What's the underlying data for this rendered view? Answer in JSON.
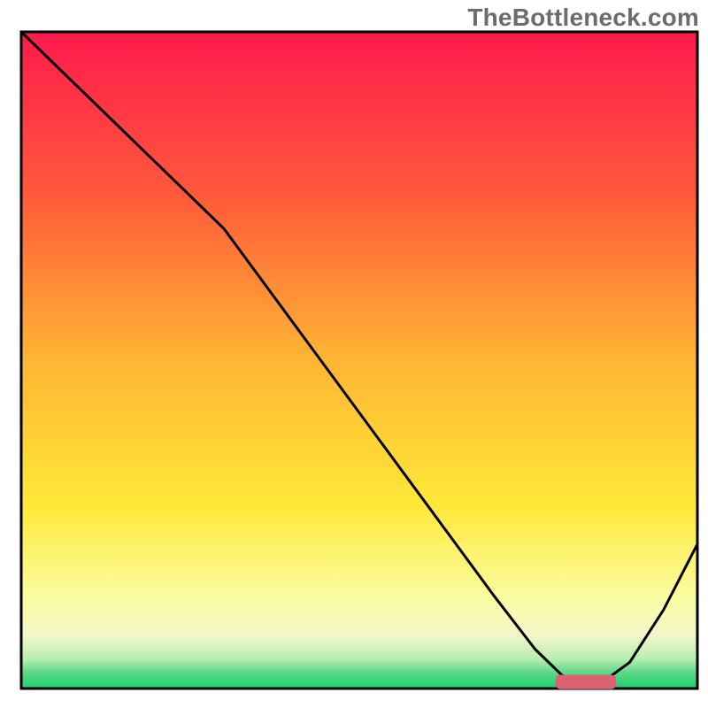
{
  "watermark": "TheBottleneck.com",
  "chart_data": {
    "type": "line",
    "title": "",
    "xlabel": "",
    "ylabel": "",
    "xlim": [
      0,
      100
    ],
    "ylim": [
      0,
      100
    ],
    "grid": false,
    "legend": false,
    "axes_visible": false,
    "background_gradient_stops": [
      {
        "offset": 0.0,
        "color": "#ff1a4d"
      },
      {
        "offset": 0.25,
        "color": "#ff5a3a"
      },
      {
        "offset": 0.5,
        "color": "#ffb534"
      },
      {
        "offset": 0.72,
        "color": "#ffe838"
      },
      {
        "offset": 0.86,
        "color": "#fbfca0"
      },
      {
        "offset": 0.92,
        "color": "#f2f7c9"
      },
      {
        "offset": 0.955,
        "color": "#b8edb0"
      },
      {
        "offset": 0.975,
        "color": "#5fd98a"
      },
      {
        "offset": 1.0,
        "color": "#1ecf6d"
      }
    ],
    "series": [
      {
        "name": "bottleneck-curve",
        "color": "#000000",
        "stroke_width": 3,
        "x": [
          0,
          6,
          12,
          18,
          24,
          30,
          40,
          50,
          60,
          70,
          76,
          80,
          83,
          86,
          90,
          95,
          100
        ],
        "y": [
          100,
          94,
          88,
          82,
          76,
          70,
          56,
          42,
          28,
          14,
          6,
          2,
          1,
          1,
          4,
          12,
          22
        ]
      }
    ],
    "marker": {
      "name": "optimal-range",
      "color": "#d9636e",
      "x_start": 79,
      "x_end": 88,
      "y": 1,
      "thickness": 2.2
    },
    "plot_frame": {
      "color": "#000000",
      "width": 3
    }
  }
}
